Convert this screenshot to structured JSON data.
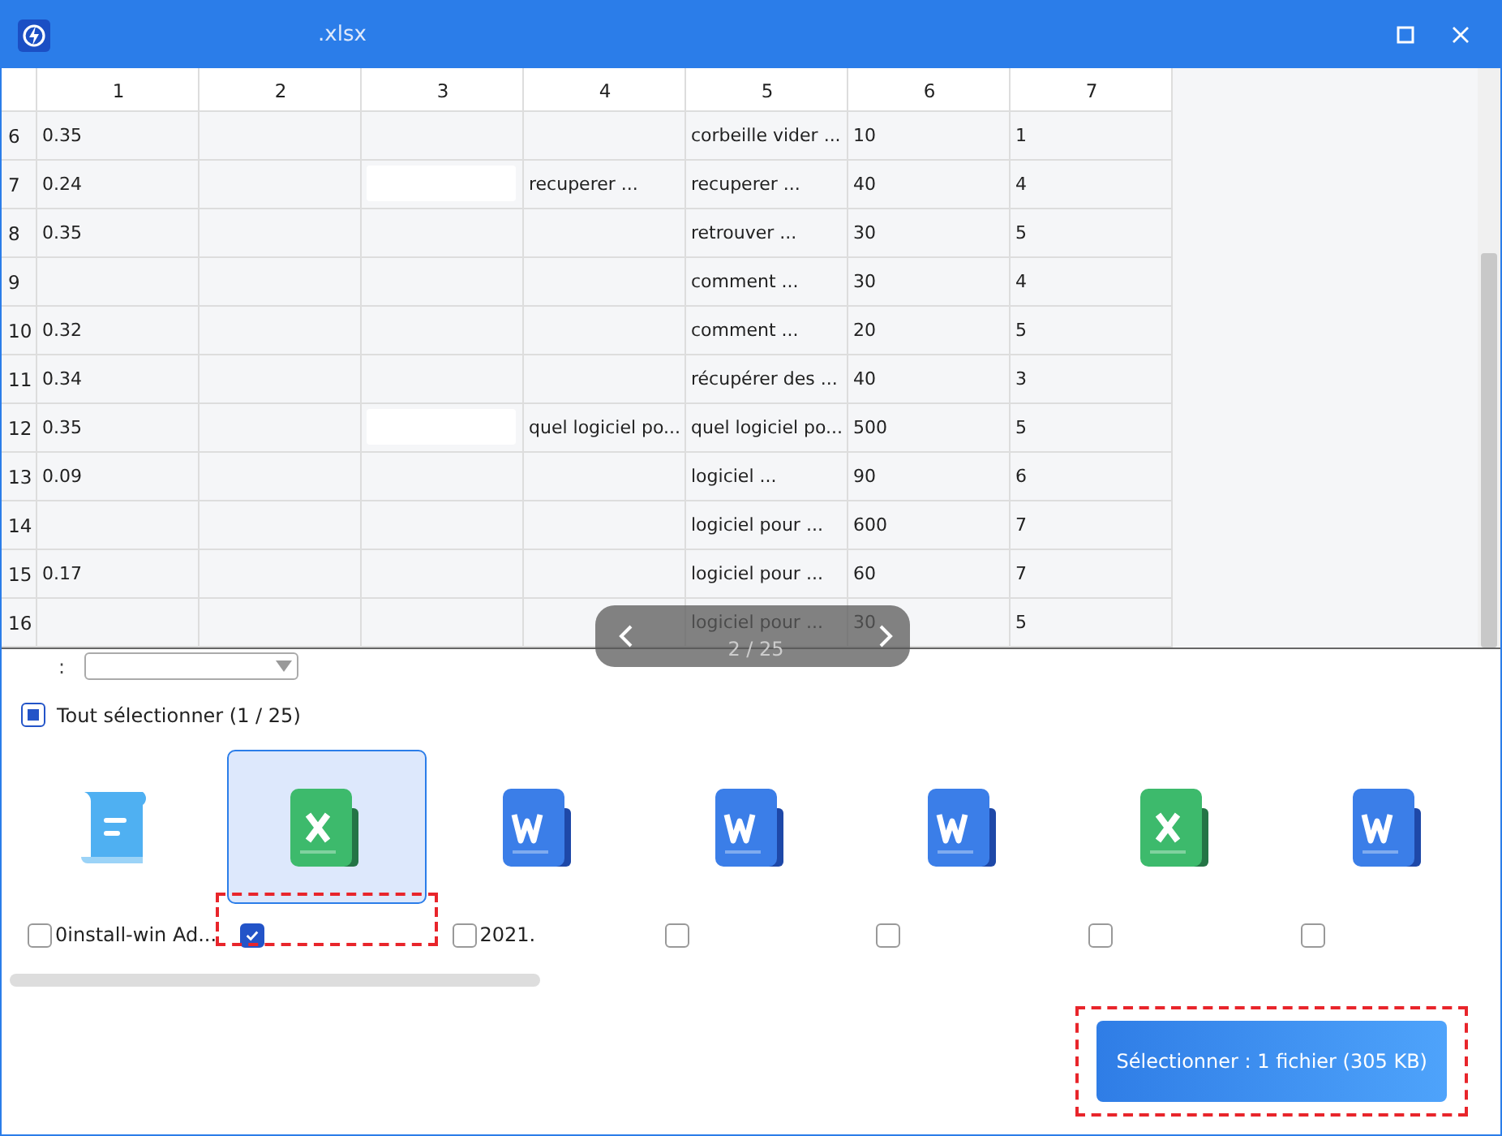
{
  "window": {
    "title": ".xlsx"
  },
  "sheet": {
    "columns": [
      "1",
      "2",
      "3",
      "4",
      "5",
      "6",
      "7"
    ],
    "rows": [
      {
        "number": "6",
        "cells": [
          "0.35",
          null,
          null,
          null,
          "corbeille vider ...",
          "10",
          "1"
        ]
      },
      {
        "number": "7",
        "cells": [
          "0.24",
          null,
          {
            "masked": true
          },
          "recuperer ...",
          "recuperer ...",
          "40",
          "4"
        ]
      },
      {
        "number": "8",
        "cells": [
          "0.35",
          null,
          null,
          null,
          "retrouver ...",
          "30",
          "5"
        ]
      },
      {
        "number": "9",
        "cells": [
          null,
          null,
          null,
          null,
          "comment ...",
          "30",
          "4"
        ]
      },
      {
        "number": "10",
        "cells": [
          "0.32",
          null,
          null,
          null,
          "comment ...",
          "20",
          "5"
        ]
      },
      {
        "number": "11",
        "cells": [
          "0.34",
          null,
          null,
          null,
          "récupérer des ...",
          "40",
          "3"
        ]
      },
      {
        "number": "12",
        "cells": [
          "0.35",
          null,
          {
            "masked": true
          },
          "quel logiciel po...",
          "quel logiciel po...",
          "500",
          "5"
        ]
      },
      {
        "number": "13",
        "cells": [
          "0.09",
          null,
          null,
          null,
          "logiciel ...",
          "90",
          "6"
        ]
      },
      {
        "number": "14",
        "cells": [
          null,
          null,
          null,
          null,
          "logiciel pour ...",
          "600",
          "7"
        ]
      },
      {
        "number": "15",
        "cells": [
          "0.17",
          null,
          null,
          null,
          "logiciel pour ...",
          "60",
          "7"
        ]
      },
      {
        "number": "16",
        "cells": [
          null,
          null,
          null,
          null,
          "logiciel pour ...",
          "30",
          "5"
        ]
      }
    ]
  },
  "pager": {
    "text": "2 / 25"
  },
  "sheet_bar": {
    "separator": ":"
  },
  "select_all": {
    "label": "Tout sélectionner (1 / 25)",
    "indeterminate": true
  },
  "files": [
    {
      "kind": "text",
      "name": "0install-win Ad...",
      "selected": false,
      "checked": false
    },
    {
      "kind": "excel",
      "selected": true,
      "checked": true,
      "highlighted": true
    },
    {
      "kind": "word",
      "name": "2021.",
      "selected": false,
      "checked": false
    },
    {
      "kind": "word",
      "selected": false,
      "checked": false
    },
    {
      "kind": "word",
      "selected": false,
      "checked": false
    },
    {
      "kind": "excel",
      "selected": false,
      "checked": false
    },
    {
      "kind": "word",
      "selected": false,
      "checked": false
    }
  ],
  "confirm_button": {
    "label": "Sélectionner : 1 fichier (305 KB)",
    "highlighted": true
  }
}
